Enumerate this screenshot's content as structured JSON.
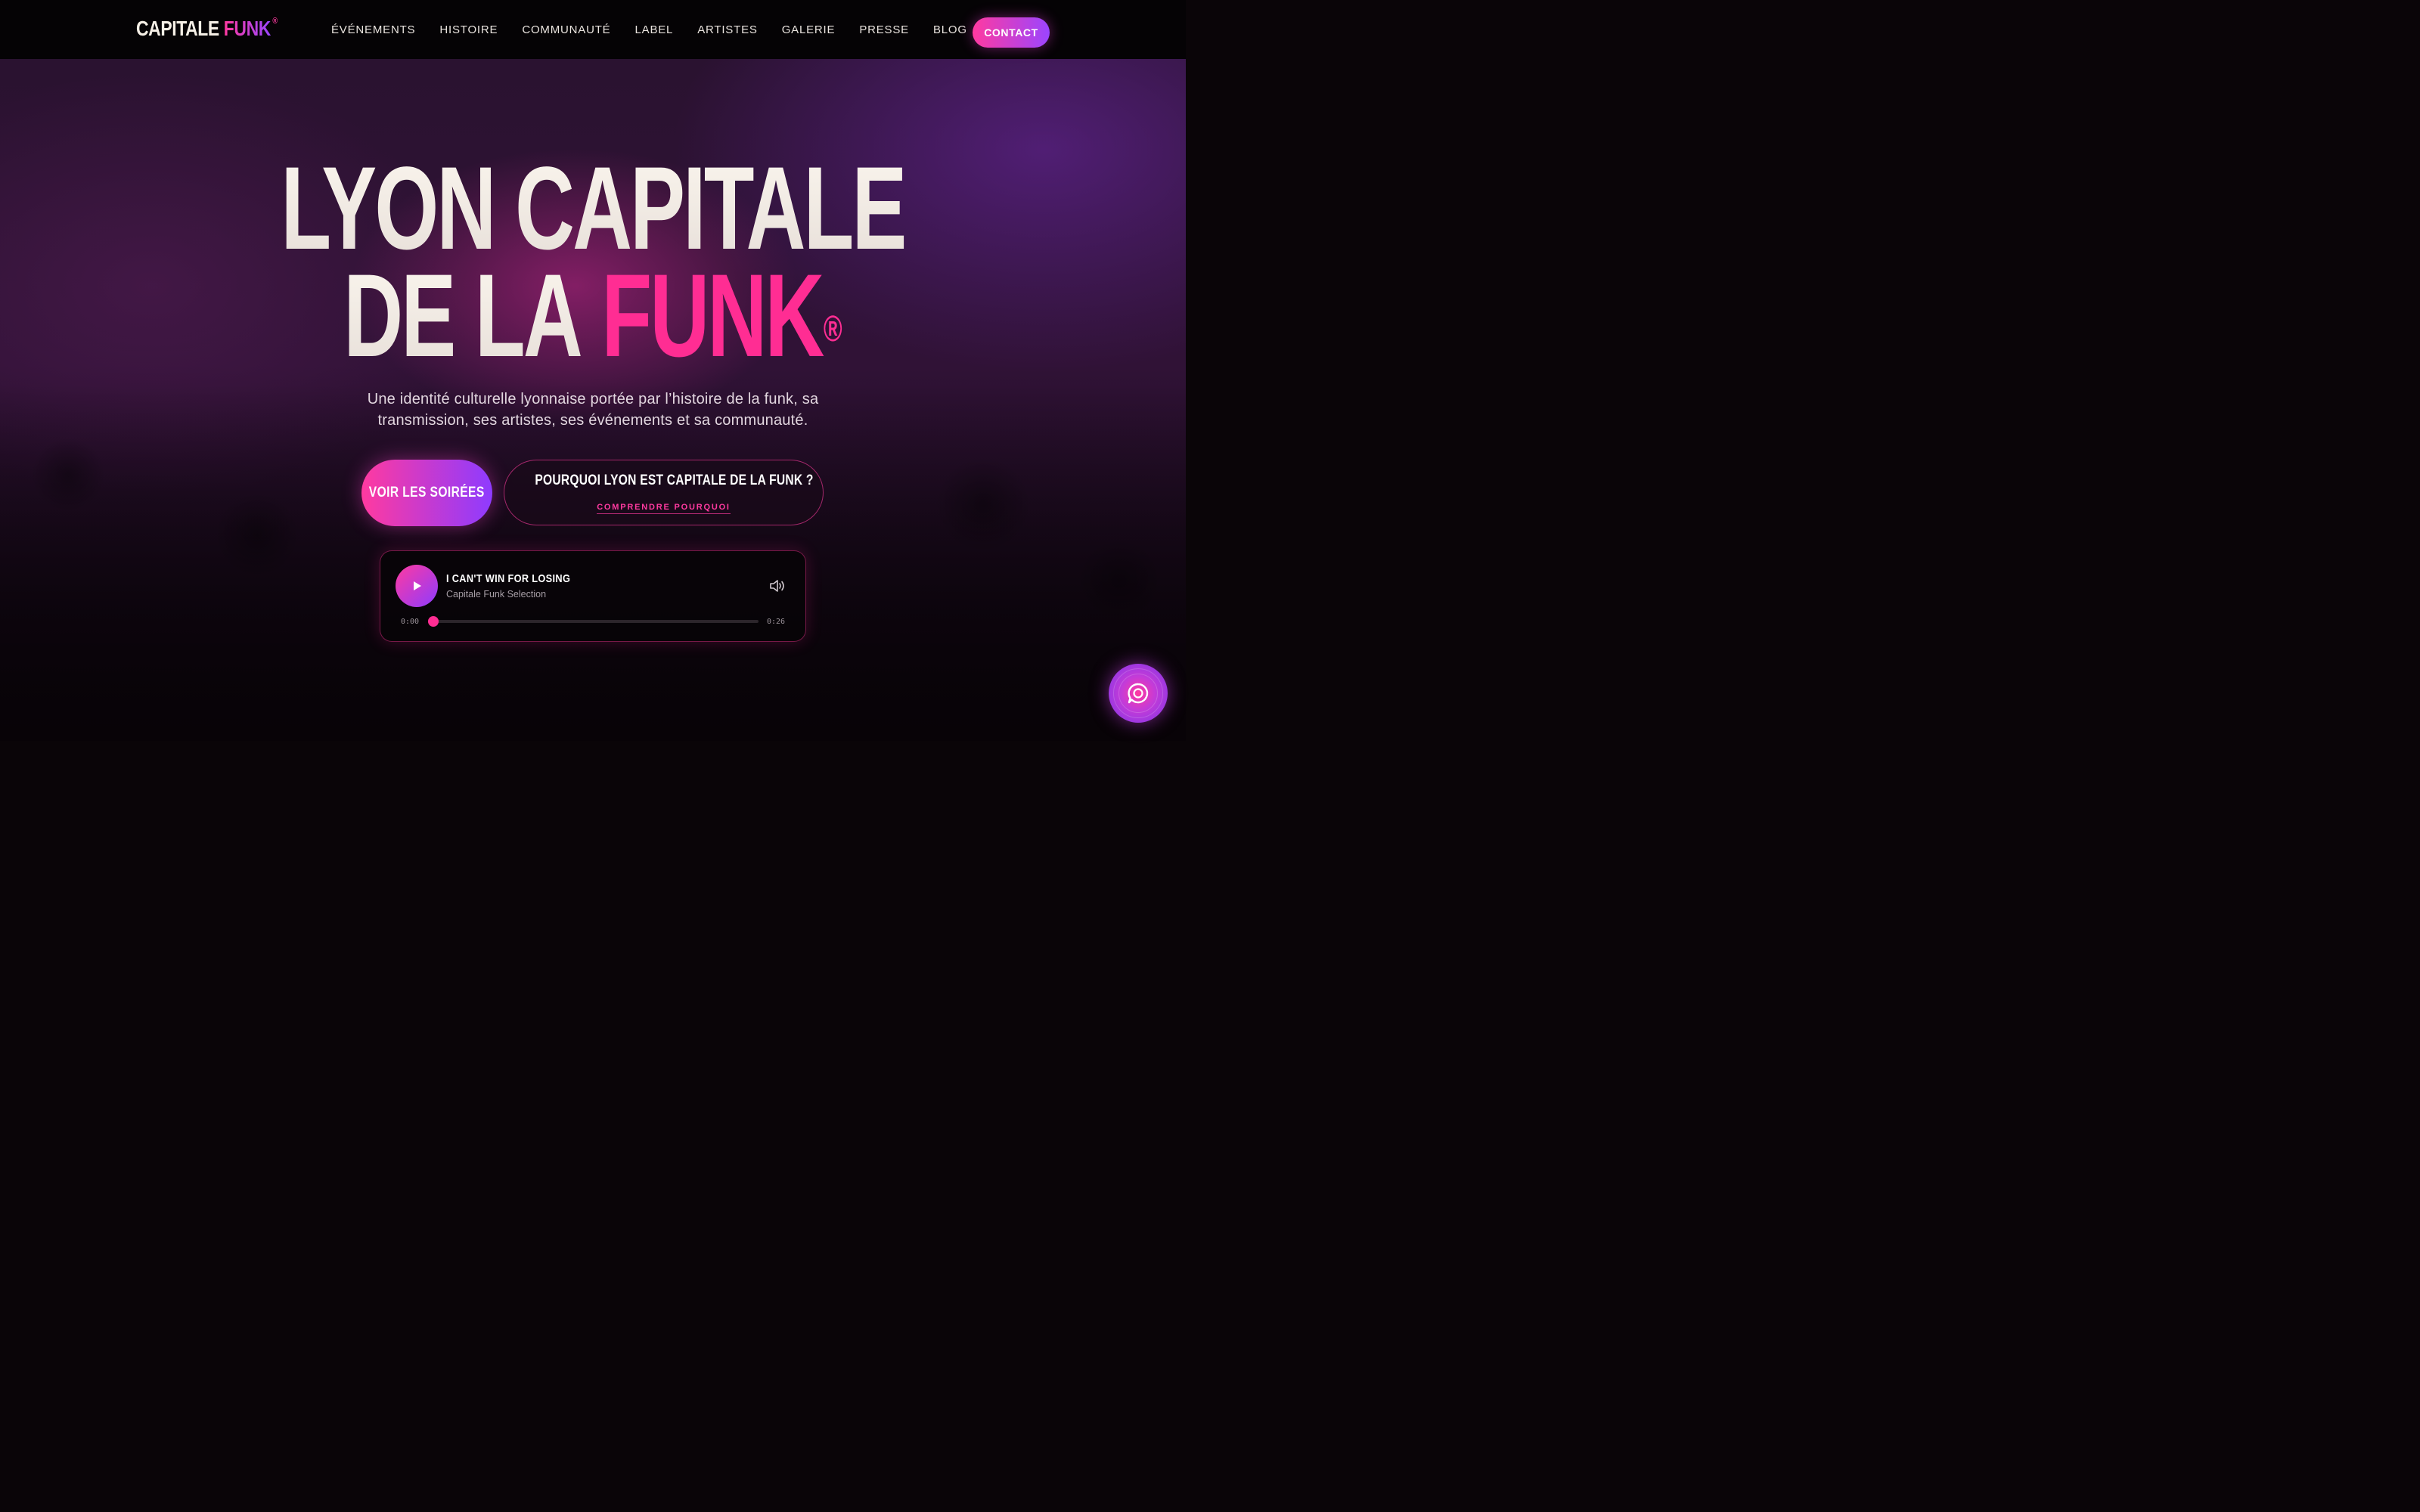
{
  "nav": {
    "logo_word1": "CAPITALE",
    "logo_word2": "FUNK",
    "logo_mark": "®",
    "links": [
      "ÉVÉNEMENTS",
      "HISTOIRE",
      "COMMUNAUTÉ",
      "LABEL",
      "ARTISTES",
      "GALERIE",
      "PRESSE",
      "BLOG"
    ],
    "contact_label": "CONTACT"
  },
  "hero": {
    "title_line1": "LYON CAPITALE",
    "title_line2_light": "DE LA",
    "title_line2_accent": "FUNK",
    "title_mark": "®",
    "subtitle": "Une identité culturelle lyonnaise portée par l’histoire de la funk, sa transmission, ses artistes, ses événements et sa communauté.",
    "primary_cta": "VOIR LES SOIRÉES",
    "secondary_cta": "POURQUOI LYON EST CAPITALE DE LA FUNK ?",
    "secondary_cta_link": "COMPRENDRE POURQUOI"
  },
  "player": {
    "track_title": "I CAN'T WIN FOR LOSING",
    "track_artist": "Capitale Funk Selection",
    "current_time": "0:00",
    "duration": "0:26",
    "progress": 0
  },
  "colors": {
    "accent_pink": "#ff2d93",
    "accent_purple": "#8e3bff",
    "cream": "#f5efe6"
  },
  "icons": {
    "play": "play-icon",
    "volume": "volume-icon",
    "chat": "chat-icon"
  }
}
